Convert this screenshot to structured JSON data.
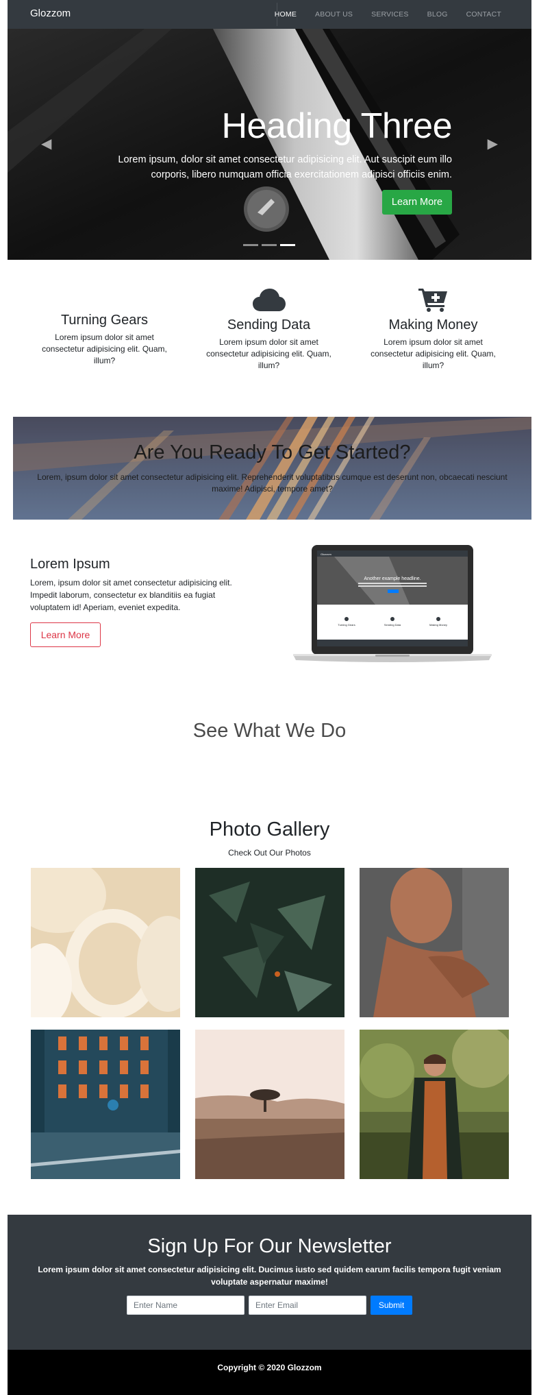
{
  "navbar": {
    "brand": "Glozzom",
    "items": [
      {
        "label": "HOME",
        "active": true
      },
      {
        "label": "ABOUT US",
        "active": false
      },
      {
        "label": "SERVICES",
        "active": false
      },
      {
        "label": "BLOG",
        "active": false
      },
      {
        "label": "CONTACT",
        "active": false
      }
    ],
    "background": "#343a40"
  },
  "hero": {
    "title": "Heading Three",
    "text": "Lorem ipsum, dolor sit amet consectetur adipisicing elit. Aut suscipit eum illo corporis, libero numquam officia exercitationem adipisci officiis enim.",
    "button": "Learn More",
    "button_color": "#28a745",
    "prev_icon": "chevron-left-icon",
    "next_icon": "chevron-right-icon",
    "slides": 3,
    "active_slide": 3
  },
  "features": [
    {
      "title": "Turning Gears",
      "text": "Lorem ipsum dolor sit amet consectetur adipisicing elit. Quam, illum?",
      "icon": "gears-icon"
    },
    {
      "title": "Sending Data",
      "text": "Lorem ipsum dolor sit amet consectetur adipisicing elit. Quam, illum?",
      "icon": "cloud-icon"
    },
    {
      "title": "Making Money",
      "text": "Lorem ipsum dolor sit amet consectetur adipisicing elit. Quam, illum?",
      "icon": "cart-plus-icon"
    }
  ],
  "cta": {
    "title": "Are You Ready To Get Started?",
    "text": "Lorem, ipsum dolor sit amet consectetur adipisicing elit. Reprehenderit voluptatibus cumque est deserunt non, obcaecati nesciunt maxime! Adipisci, tempore amet?"
  },
  "info": {
    "title": "Lorem Ipsum",
    "text": "Lorem, ipsum dolor sit amet consectetur adipisicing elit. Impedit laborum, consectetur ex blanditiis ea fugiat voluptatem id! Aperiam, eveniet expedita.",
    "button": "Learn More",
    "button_color": "#dc3545"
  },
  "laptop_screen": {
    "brand": "Glozzom",
    "headline": "Another example headline.",
    "features": [
      "Turning Gears",
      "Sending Data",
      "Making Money"
    ]
  },
  "see_title": "See What We Do",
  "gallery": {
    "title": "Photo Gallery",
    "subtitle": "Check Out Our Photos",
    "photos": [
      "white-cups-photo",
      "thorny-plant-photo",
      "woman-portrait-photo",
      "building-street-photo",
      "desert-tree-photo",
      "woman-garden-photo"
    ]
  },
  "newsletter": {
    "title": "Sign Up For Our Newsletter",
    "text": "Lorem ipsum dolor sit amet consectetur adipisicing elit. Ducimus iusto sed quidem earum facilis tempora fugit veniam voluptate aspernatur maxime!",
    "name_placeholder": "Enter Name",
    "email_placeholder": "Enter Email",
    "submit": "Submit",
    "submit_color": "#007bff"
  },
  "footer": {
    "copyright": "Copyright © 2020 Glozzom"
  }
}
